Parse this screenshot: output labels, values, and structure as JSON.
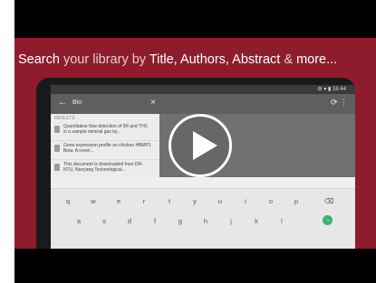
{
  "headline": {
    "word1": "Search",
    "word2": " your library by ",
    "word3": "Title, Authors, Abstract",
    "word4": " & ",
    "word5": "more..."
  },
  "device": {
    "status_time": "⚙ ▾ ▮ 16:44",
    "search_query": "Bio",
    "back_glyph": "←",
    "clear_glyph": "×",
    "right_glyphs": "⟳  ⋮",
    "results_header": "RESULTS",
    "results": [
      {
        "text": "Quantitative flow detection of 5R and THC in a sample mineral gas by..."
      },
      {
        "text": "Gene expression profile on chicken HBMP1 Beta: A novel..."
      },
      {
        "text": "This document is downloaded from DR-NTU, Nanyang Technological..."
      }
    ]
  },
  "keyboard": {
    "row1": [
      "q",
      "w",
      "e",
      "r",
      "t",
      "y",
      "u",
      "i",
      "o",
      "p",
      "⌫"
    ],
    "row2": [
      "a",
      "s",
      "d",
      "f",
      "g",
      "h",
      "j",
      "k",
      "l",
      "→"
    ]
  },
  "colors": {
    "banner": "#8e1c2c",
    "play": "#ffffff",
    "go_key": "#3bb273"
  }
}
